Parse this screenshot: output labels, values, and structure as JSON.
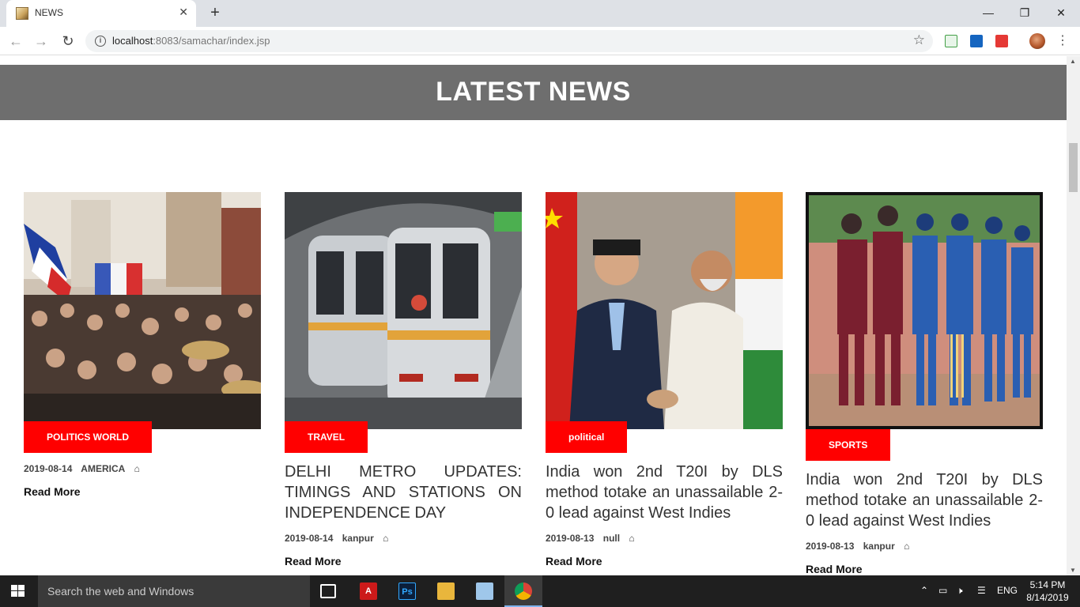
{
  "browser": {
    "tab_title": "NEWS",
    "url_host": "localhost",
    "url_rest": ":8083/samachar/index.jsp"
  },
  "page": {
    "banner_title": "LATEST NEWS"
  },
  "cards": [
    {
      "category": "POLITICS WORLD",
      "headline": "",
      "date": "2019-08-14",
      "location": "AMERICA",
      "read_more": "Read More"
    },
    {
      "category": "TRAVEL",
      "headline": "DELHI METRO UPDATES: TIMINGS AND STATIONS ON INDEPENDENCE DAY",
      "date": "2019-08-14",
      "location": "kanpur",
      "read_more": "Read More"
    },
    {
      "category": "political",
      "headline": "India won 2nd T20I by DLS method totake an unassailable 2-0 lead against West Indies",
      "date": "2019-08-13",
      "location": "null",
      "read_more": "Read More"
    },
    {
      "category": "SPORTS",
      "headline": "India won 2nd T20I by DLS method totake an unassailable 2-0 lead against West Indies",
      "date": "2019-08-13",
      "location": "kanpur",
      "read_more": "Read More"
    }
  ],
  "taskbar": {
    "search_placeholder": "Search the web and Windows",
    "language": "ENG",
    "time": "5:14 PM",
    "date": "8/14/2019"
  },
  "colors": {
    "banner": "#6e6e6e",
    "badge": "#ff0000"
  }
}
